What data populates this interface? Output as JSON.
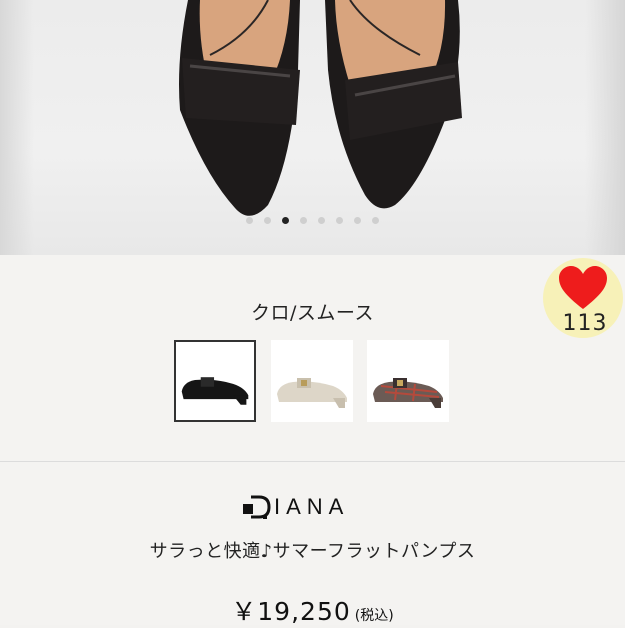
{
  "gallery": {
    "dot_count": 8,
    "active_index": 2
  },
  "product": {
    "color_name": "クロ/スムース",
    "brand": "IANA",
    "name": "サラっと快適♪サマーフラットパンプス",
    "price": "￥19,250",
    "tax_note": "(税込)"
  },
  "like": {
    "count": "113",
    "heart_color": "#ee1c1c",
    "badge_color": "#f7f1b8"
  },
  "swatches": [
    {
      "name": "black",
      "selected": true
    },
    {
      "name": "beige",
      "selected": false
    },
    {
      "name": "tweed",
      "selected": false
    }
  ]
}
